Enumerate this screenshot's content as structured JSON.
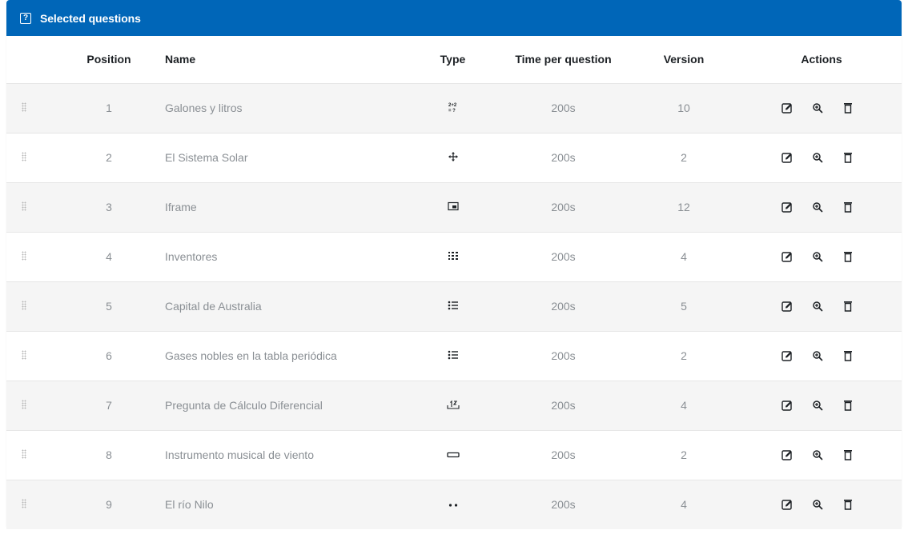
{
  "header": {
    "title": "Selected questions",
    "accent": "#0066b8"
  },
  "columns": {
    "position": "Position",
    "name": "Name",
    "type": "Type",
    "time": "Time per question",
    "version": "Version",
    "actions": "Actions"
  },
  "rows": [
    {
      "position": "1",
      "name": "Galones y litros",
      "type_icon": "calculated-icon",
      "type_glyph": "2+2\n=?",
      "time": "200s",
      "version": "10"
    },
    {
      "position": "2",
      "name": "El Sistema Solar",
      "type_icon": "drag-drop-icon",
      "type_glyph": "✥",
      "time": "200s",
      "version": "2"
    },
    {
      "position": "3",
      "name": "Iframe",
      "type_icon": "iframe-icon",
      "type_glyph": "▣",
      "time": "200s",
      "version": "12"
    },
    {
      "position": "4",
      "name": "Inventores",
      "type_icon": "matching-icon",
      "type_glyph": "⁝⁝⁝",
      "time": "200s",
      "version": "4"
    },
    {
      "position": "5",
      "name": "Capital de Australia",
      "type_icon": "multichoice-icon",
      "type_glyph": "⁝☰",
      "time": "200s",
      "version": "5"
    },
    {
      "position": "6",
      "name": "Gases nobles en la tabla periódica",
      "type_icon": "multichoice-icon",
      "type_glyph": "⁝☰",
      "time": "200s",
      "version": "2"
    },
    {
      "position": "7",
      "name": "Pregunta de Cálculo Diferencial",
      "type_icon": "numerical-icon",
      "type_glyph": "⎍",
      "time": "200s",
      "version": "4"
    },
    {
      "position": "8",
      "name": "Instrumento musical de viento",
      "type_icon": "short-answer-icon",
      "type_glyph": "▭",
      "time": "200s",
      "version": "2"
    },
    {
      "position": "9",
      "name": "El río Nilo",
      "type_icon": "true-false-icon",
      "type_glyph": "••",
      "time": "200s",
      "version": "4"
    }
  ],
  "actions": [
    "edit-icon",
    "preview-icon",
    "delete-icon"
  ]
}
